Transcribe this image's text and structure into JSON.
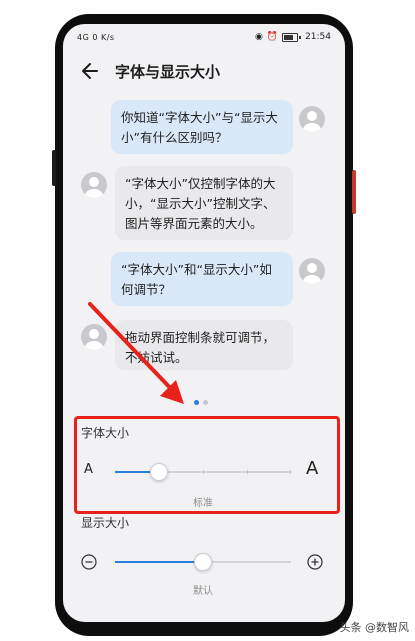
{
  "status_bar": {
    "left": "4G  0 K/s",
    "time": "21:54",
    "battery": "70"
  },
  "header": {
    "title": "字体与显示大小"
  },
  "chat": {
    "q1": "你知道“字体大小”与“显示大小”有什么区别吗？",
    "a1": "“字体大小”仅控制字体的大小，“显示大小”控制文字、图片等界面元素的大小。",
    "q2": "“字体大小”和“显示大小”如何调节？",
    "a2": "拖动界面控制条就可调节，不妨试试。"
  },
  "pager": {
    "pages": 2,
    "current": 1
  },
  "font_size": {
    "label": "字体大小",
    "small_glyph": "A",
    "large_glyph": "A",
    "level_name": "标准",
    "level": 0.25
  },
  "display_size": {
    "label": "显示大小",
    "level_name": "默认",
    "level": 0.5
  },
  "watermark": "头条 @数智风",
  "colors": {
    "accent": "#2b7de0",
    "highlight": "#e8221b"
  }
}
